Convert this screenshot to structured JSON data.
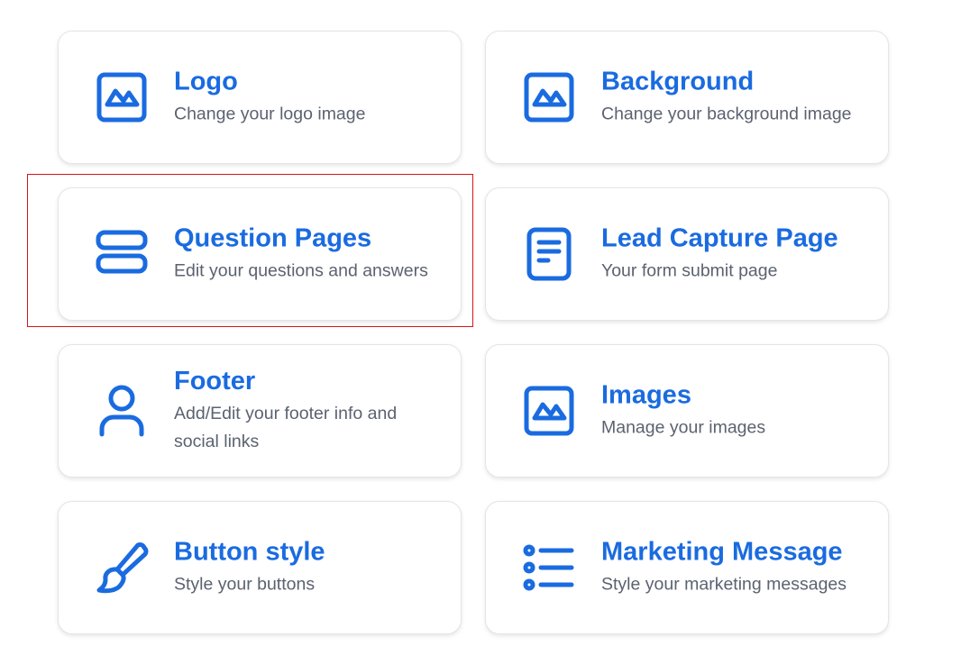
{
  "cards": [
    {
      "id": "logo",
      "title": "Logo",
      "description": "Change your logo image",
      "icon": "image-icon"
    },
    {
      "id": "background",
      "title": "Background",
      "description": "Change your background image",
      "icon": "image-icon"
    },
    {
      "id": "question-pages",
      "title": "Question Pages",
      "description": "Edit your questions and answers",
      "icon": "stacked-rows-icon",
      "highlighted": true
    },
    {
      "id": "lead-capture-page",
      "title": "Lead Capture Page",
      "description": "Your form submit page",
      "icon": "document-icon"
    },
    {
      "id": "footer",
      "title": "Footer",
      "description": "Add/Edit your footer info and social links",
      "icon": "user-icon"
    },
    {
      "id": "images",
      "title": "Images",
      "description": "Manage your images",
      "icon": "image-icon"
    },
    {
      "id": "button-style",
      "title": "Button style",
      "description": "Style your buttons",
      "icon": "paintbrush-icon"
    },
    {
      "id": "marketing-message",
      "title": "Marketing Message",
      "description": "Style your marketing messages",
      "icon": "list-icon"
    }
  ],
  "colors": {
    "accent": "#1a6be0",
    "description_text": "#5b6270",
    "card_border": "#e3e5ea",
    "highlight_box": "#d0171b"
  }
}
